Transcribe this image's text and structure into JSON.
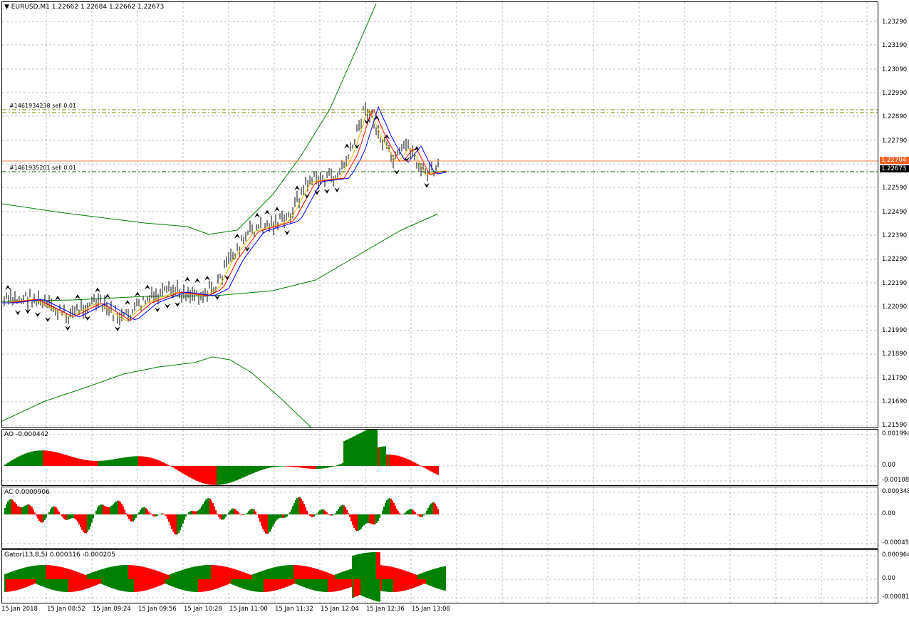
{
  "main": {
    "symbol_title": "EURUSD,M1",
    "ohlc": "1.22662 1.22684 1.22662 1.22673",
    "price_labels": [
      "1.23290",
      "1.23190",
      "1.23090",
      "1.22990",
      "1.22890",
      "1.22790",
      "1.22590",
      "1.22490",
      "1.22390",
      "1.22290",
      "1.22190",
      "1.22090",
      "1.21990",
      "1.21890",
      "1.21790",
      "1.21690",
      "1.21590"
    ],
    "ask_tag": "1.22704",
    "bid_tag": "1.22673",
    "orders": [
      {
        "label": "#1461934238 sell 0.01"
      },
      {
        "label": "#1461935201 sell 0.01"
      }
    ],
    "colors": {
      "ask_line": "#f08040",
      "bid_tag_bg": "#000000",
      "ask_tag_bg": "#f06020",
      "bull": "#008000",
      "bear": "#ff0000"
    }
  },
  "ao": {
    "title": "AO -0.000442",
    "labels": [
      "0.001994",
      "0.00",
      "-0.001084"
    ]
  },
  "ac": {
    "title": "AC 0.0000906",
    "labels": [
      "0.000348",
      "0.00",
      "-0.000458"
    ]
  },
  "gator": {
    "title": "Gator(13,8,5) 0.000316 -0.000205",
    "labels": [
      "0.000964",
      "0.00",
      "-0.000814"
    ]
  },
  "time_axis": [
    "15 Jan 2018",
    "15 Jan 08:52",
    "15 Jan 09:24",
    "15 Jan 09:56",
    "15 Jan 10:28",
    "15 Jan 11:00",
    "15 Jan 11:32",
    "15 Jan 12:04",
    "15 Jan 12:36",
    "15 Jan 13:08"
  ]
}
